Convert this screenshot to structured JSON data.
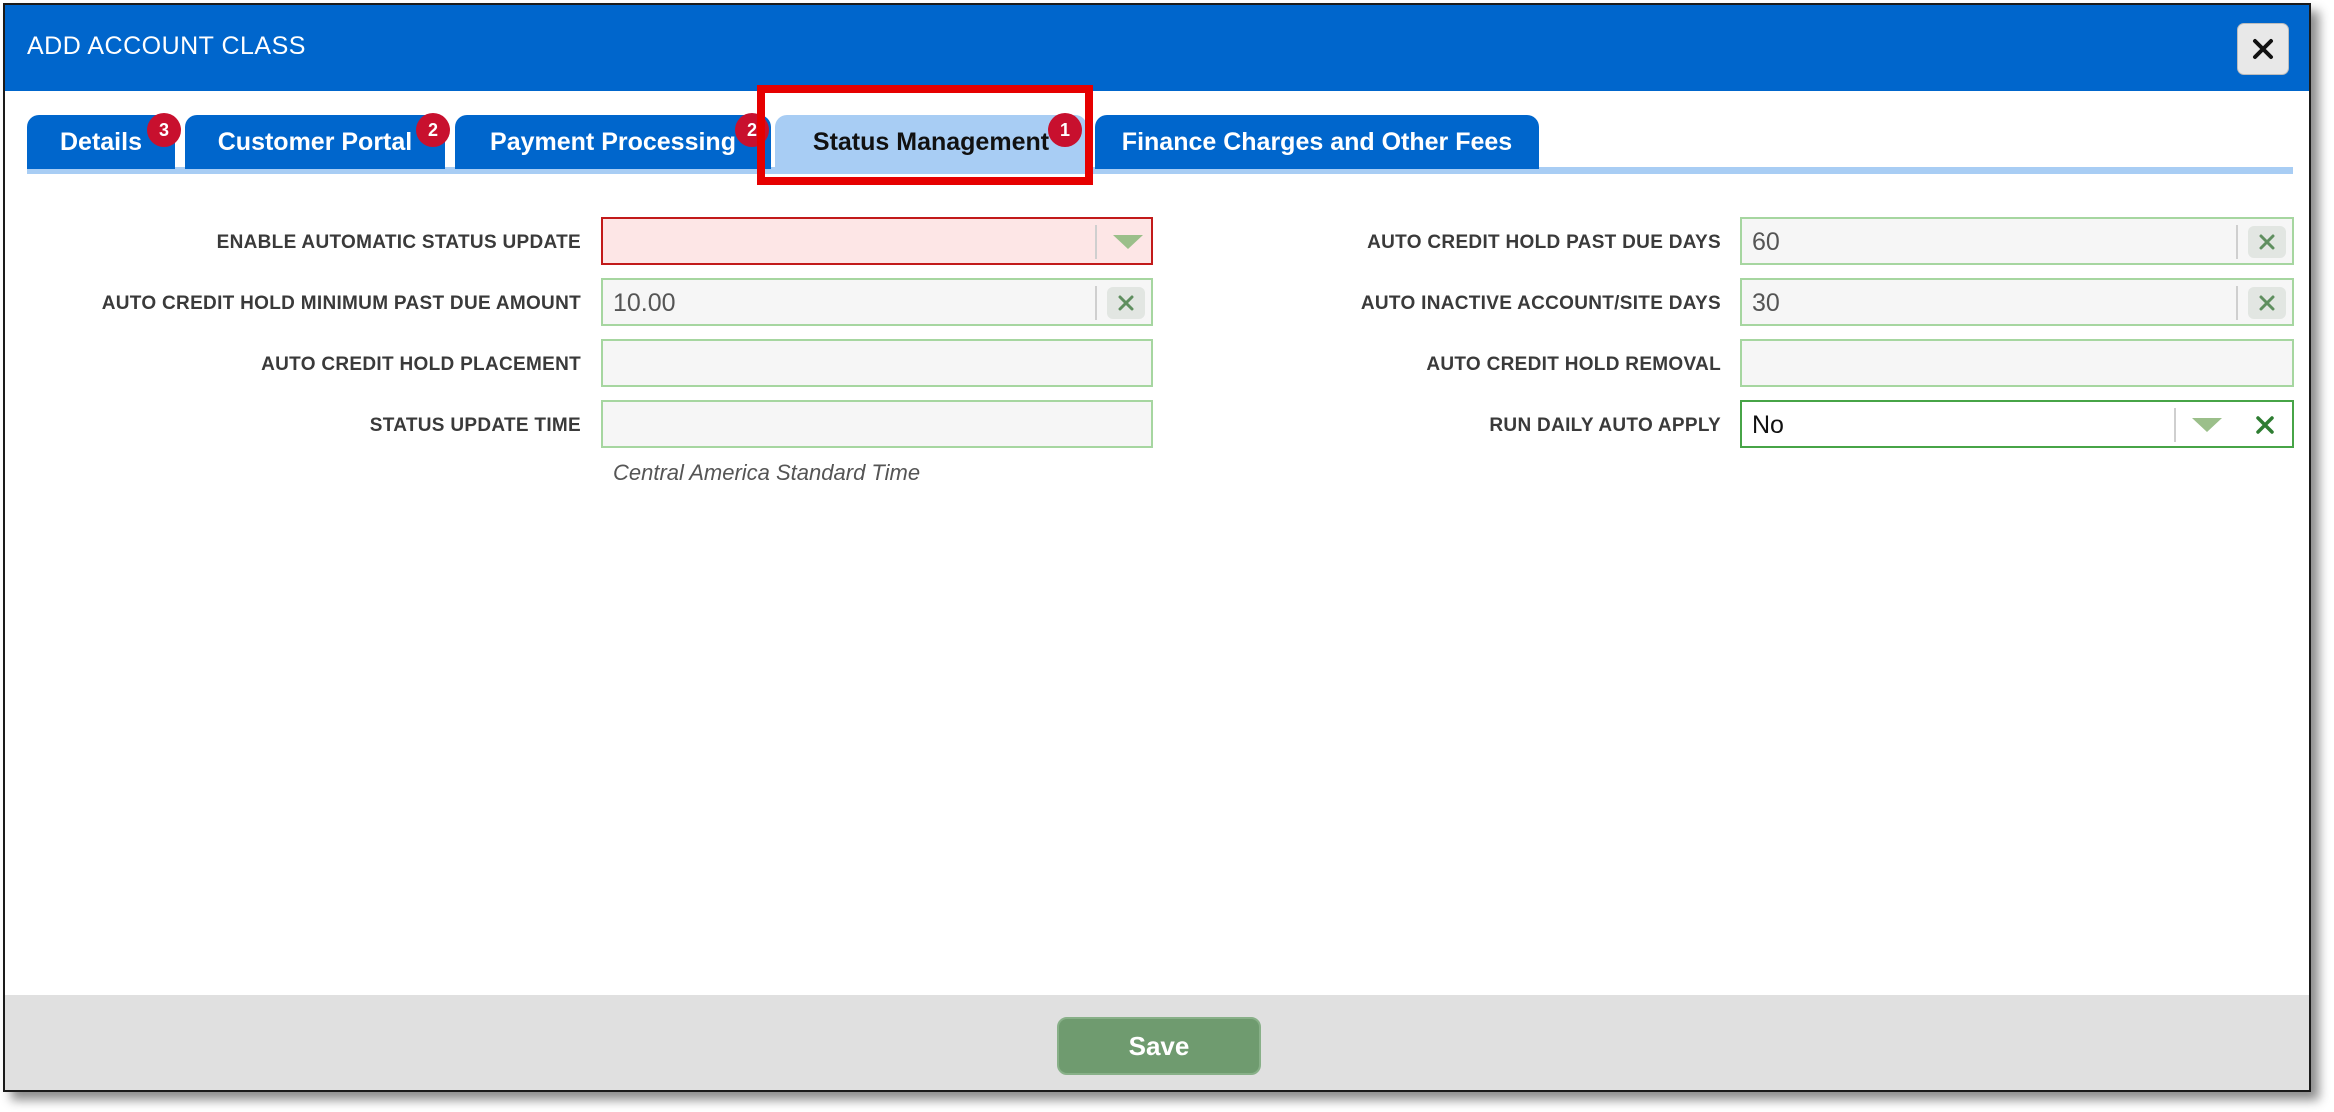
{
  "dialog": {
    "title": "ADD ACCOUNT CLASS",
    "close_icon": "close-icon"
  },
  "tabs": [
    {
      "label": "Details",
      "badge": "3",
      "active": false
    },
    {
      "label": "Customer Portal",
      "badge": "2",
      "active": false
    },
    {
      "label": "Payment Processing",
      "badge": "2",
      "active": false
    },
    {
      "label": "Status Management",
      "badge": "1",
      "active": true
    },
    {
      "label": "Finance Charges and Other Fees",
      "badge": "",
      "active": false
    }
  ],
  "form": {
    "left": [
      {
        "label": "ENABLE AUTOMATIC STATUS UPDATE",
        "value": "",
        "type": "select",
        "state": "error"
      },
      {
        "label": "AUTO CREDIT HOLD MINIMUM PAST DUE AMOUNT",
        "value": "10.00",
        "type": "text",
        "clearable": true
      },
      {
        "label": "AUTO CREDIT HOLD PLACEMENT",
        "value": "",
        "type": "text"
      },
      {
        "label": "STATUS UPDATE TIME",
        "value": "",
        "type": "text"
      }
    ],
    "status_update_time_hint": "Central America Standard Time",
    "right": [
      {
        "label": "AUTO CREDIT HOLD PAST DUE DAYS",
        "value": "60",
        "type": "text",
        "clearable": true
      },
      {
        "label": "AUTO INACTIVE ACCOUNT/SITE DAYS",
        "value": "30",
        "type": "text",
        "clearable": true
      },
      {
        "label": "AUTO CREDIT HOLD REMOVAL",
        "value": "",
        "type": "text"
      },
      {
        "label": "RUN DAILY AUTO APPLY",
        "value": "No",
        "type": "select",
        "clearable": true
      }
    ]
  },
  "footer": {
    "save_label": "Save"
  },
  "colors": {
    "header_blue": "#0066cc",
    "active_tab": "#a8cdf4",
    "badge_red": "#c8102e",
    "highlight_red": "#e60000",
    "save_green": "#6f9b6f"
  }
}
